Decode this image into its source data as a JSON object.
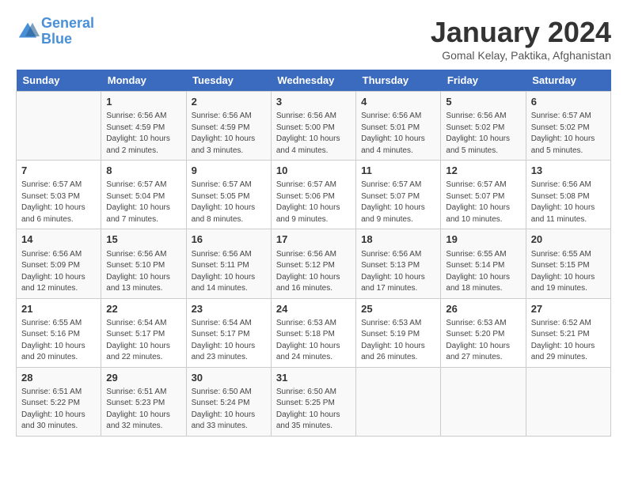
{
  "header": {
    "logo_line1": "General",
    "logo_line2": "Blue",
    "month": "January 2024",
    "location": "Gomal Kelay, Paktika, Afghanistan"
  },
  "weekdays": [
    "Sunday",
    "Monday",
    "Tuesday",
    "Wednesday",
    "Thursday",
    "Friday",
    "Saturday"
  ],
  "weeks": [
    [
      {
        "day": "",
        "info": ""
      },
      {
        "day": "1",
        "info": "Sunrise: 6:56 AM\nSunset: 4:59 PM\nDaylight: 10 hours\nand 2 minutes."
      },
      {
        "day": "2",
        "info": "Sunrise: 6:56 AM\nSunset: 4:59 PM\nDaylight: 10 hours\nand 3 minutes."
      },
      {
        "day": "3",
        "info": "Sunrise: 6:56 AM\nSunset: 5:00 PM\nDaylight: 10 hours\nand 4 minutes."
      },
      {
        "day": "4",
        "info": "Sunrise: 6:56 AM\nSunset: 5:01 PM\nDaylight: 10 hours\nand 4 minutes."
      },
      {
        "day": "5",
        "info": "Sunrise: 6:56 AM\nSunset: 5:02 PM\nDaylight: 10 hours\nand 5 minutes."
      },
      {
        "day": "6",
        "info": "Sunrise: 6:57 AM\nSunset: 5:02 PM\nDaylight: 10 hours\nand 5 minutes."
      }
    ],
    [
      {
        "day": "7",
        "info": "Sunrise: 6:57 AM\nSunset: 5:03 PM\nDaylight: 10 hours\nand 6 minutes."
      },
      {
        "day": "8",
        "info": "Sunrise: 6:57 AM\nSunset: 5:04 PM\nDaylight: 10 hours\nand 7 minutes."
      },
      {
        "day": "9",
        "info": "Sunrise: 6:57 AM\nSunset: 5:05 PM\nDaylight: 10 hours\nand 8 minutes."
      },
      {
        "day": "10",
        "info": "Sunrise: 6:57 AM\nSunset: 5:06 PM\nDaylight: 10 hours\nand 9 minutes."
      },
      {
        "day": "11",
        "info": "Sunrise: 6:57 AM\nSunset: 5:07 PM\nDaylight: 10 hours\nand 9 minutes."
      },
      {
        "day": "12",
        "info": "Sunrise: 6:57 AM\nSunset: 5:07 PM\nDaylight: 10 hours\nand 10 minutes."
      },
      {
        "day": "13",
        "info": "Sunrise: 6:56 AM\nSunset: 5:08 PM\nDaylight: 10 hours\nand 11 minutes."
      }
    ],
    [
      {
        "day": "14",
        "info": "Sunrise: 6:56 AM\nSunset: 5:09 PM\nDaylight: 10 hours\nand 12 minutes."
      },
      {
        "day": "15",
        "info": "Sunrise: 6:56 AM\nSunset: 5:10 PM\nDaylight: 10 hours\nand 13 minutes."
      },
      {
        "day": "16",
        "info": "Sunrise: 6:56 AM\nSunset: 5:11 PM\nDaylight: 10 hours\nand 14 minutes."
      },
      {
        "day": "17",
        "info": "Sunrise: 6:56 AM\nSunset: 5:12 PM\nDaylight: 10 hours\nand 16 minutes."
      },
      {
        "day": "18",
        "info": "Sunrise: 6:56 AM\nSunset: 5:13 PM\nDaylight: 10 hours\nand 17 minutes."
      },
      {
        "day": "19",
        "info": "Sunrise: 6:55 AM\nSunset: 5:14 PM\nDaylight: 10 hours\nand 18 minutes."
      },
      {
        "day": "20",
        "info": "Sunrise: 6:55 AM\nSunset: 5:15 PM\nDaylight: 10 hours\nand 19 minutes."
      }
    ],
    [
      {
        "day": "21",
        "info": "Sunrise: 6:55 AM\nSunset: 5:16 PM\nDaylight: 10 hours\nand 20 minutes."
      },
      {
        "day": "22",
        "info": "Sunrise: 6:54 AM\nSunset: 5:17 PM\nDaylight: 10 hours\nand 22 minutes."
      },
      {
        "day": "23",
        "info": "Sunrise: 6:54 AM\nSunset: 5:17 PM\nDaylight: 10 hours\nand 23 minutes."
      },
      {
        "day": "24",
        "info": "Sunrise: 6:53 AM\nSunset: 5:18 PM\nDaylight: 10 hours\nand 24 minutes."
      },
      {
        "day": "25",
        "info": "Sunrise: 6:53 AM\nSunset: 5:19 PM\nDaylight: 10 hours\nand 26 minutes."
      },
      {
        "day": "26",
        "info": "Sunrise: 6:53 AM\nSunset: 5:20 PM\nDaylight: 10 hours\nand 27 minutes."
      },
      {
        "day": "27",
        "info": "Sunrise: 6:52 AM\nSunset: 5:21 PM\nDaylight: 10 hours\nand 29 minutes."
      }
    ],
    [
      {
        "day": "28",
        "info": "Sunrise: 6:51 AM\nSunset: 5:22 PM\nDaylight: 10 hours\nand 30 minutes."
      },
      {
        "day": "29",
        "info": "Sunrise: 6:51 AM\nSunset: 5:23 PM\nDaylight: 10 hours\nand 32 minutes."
      },
      {
        "day": "30",
        "info": "Sunrise: 6:50 AM\nSunset: 5:24 PM\nDaylight: 10 hours\nand 33 minutes."
      },
      {
        "day": "31",
        "info": "Sunrise: 6:50 AM\nSunset: 5:25 PM\nDaylight: 10 hours\nand 35 minutes."
      },
      {
        "day": "",
        "info": ""
      },
      {
        "day": "",
        "info": ""
      },
      {
        "day": "",
        "info": ""
      }
    ]
  ]
}
